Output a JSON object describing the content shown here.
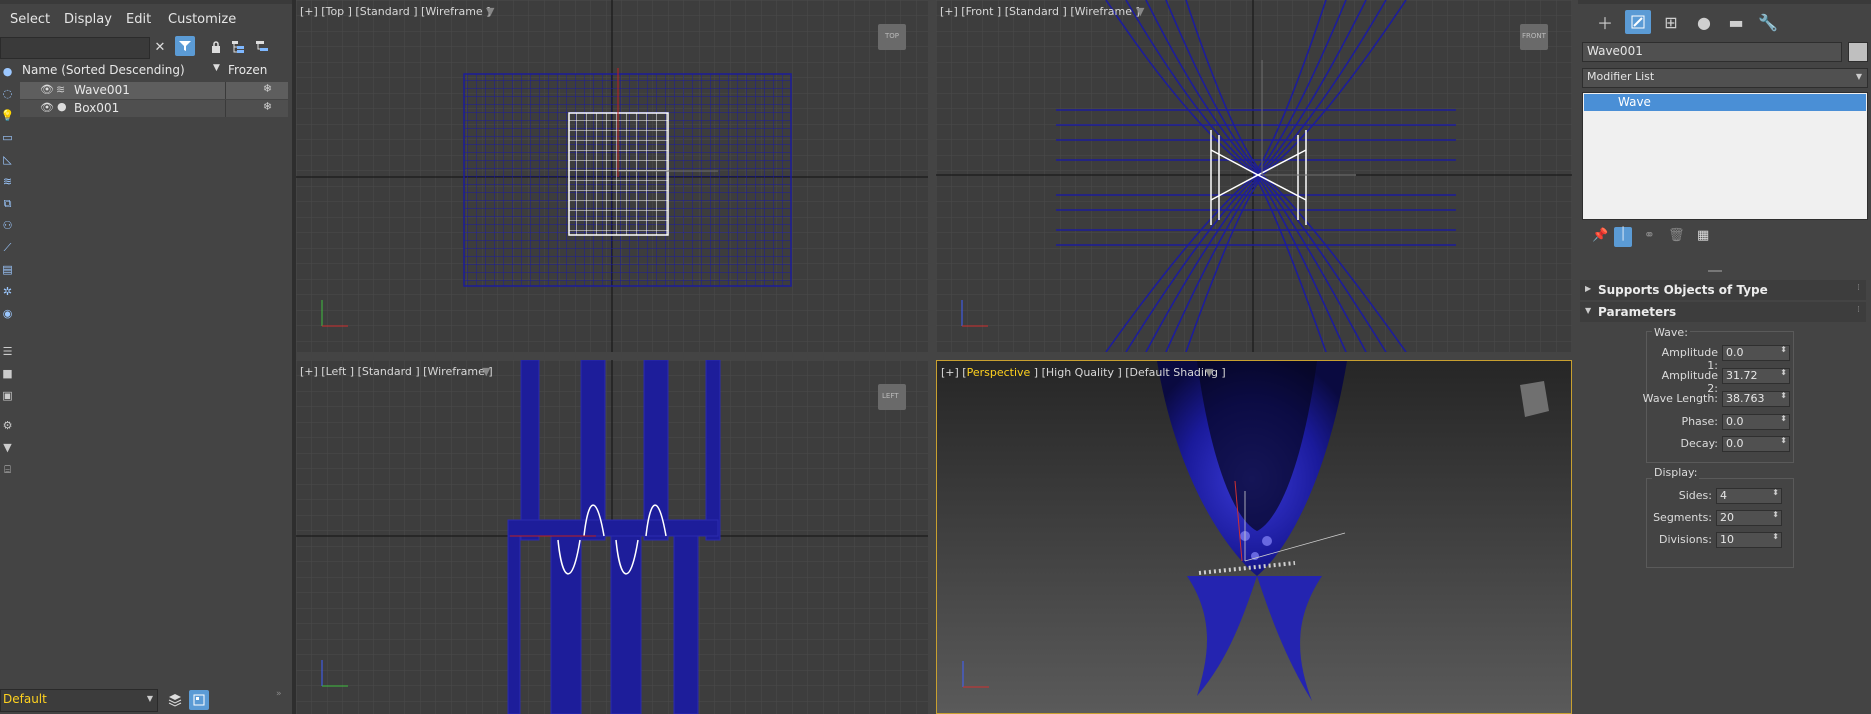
{
  "menu": [
    "Select",
    "Display",
    "Edit",
    "Customize"
  ],
  "explorer": {
    "column_name": "Name (Sorted Descending)",
    "column_frozen": "Frozen",
    "rows": [
      {
        "name": "Wave001",
        "icon": "wave-icon"
      },
      {
        "name": "Box001",
        "icon": "sphere-dot-icon"
      }
    ],
    "layer": "Default"
  },
  "viewports": {
    "top": "[+] [Top ] [Standard ] [Wireframe ]",
    "front": "[+] [Front ] [Standard ] [Wireframe ]",
    "left": "[+] [Left ] [Standard ] [Wireframe ]",
    "persp_prefix": "[+] [",
    "persp_name": "Perspective",
    "persp_suffix": " ] [High Quality ] [Default Shading ]",
    "cube_top": "TOP",
    "cube_front": "FRONT",
    "cube_left": "LEFT"
  },
  "command_panel": {
    "object_name": "Wave001",
    "modifier_list": "Modifier List",
    "stack_item": "Wave",
    "rollout_supports": "Supports Objects of Type",
    "rollout_params": "Parameters",
    "wave_group": "Wave:",
    "amplitude1_label": "Amplitude 1:",
    "amplitude1": "0.0",
    "amplitude2_label": "Amplitude 2:",
    "amplitude2": "31.72",
    "wavelength_label": "Wave Length:",
    "wavelength": "38.763",
    "phase_label": "Phase:",
    "phase": "0.0",
    "decay_label": "Decay:",
    "decay": "0.0",
    "display_group": "Display:",
    "sides_label": "Sides:",
    "sides": "4",
    "segments_label": "Segments:",
    "segments": "20",
    "divisions_label": "Divisions:",
    "divisions": "10"
  },
  "colors": {
    "accent": "#5b9bd5",
    "viewport_bg": "#3d3d3d",
    "wire_blue": "#1a1a8c",
    "active_border": "#c8a030",
    "selected_row": "#4a8fd6"
  }
}
